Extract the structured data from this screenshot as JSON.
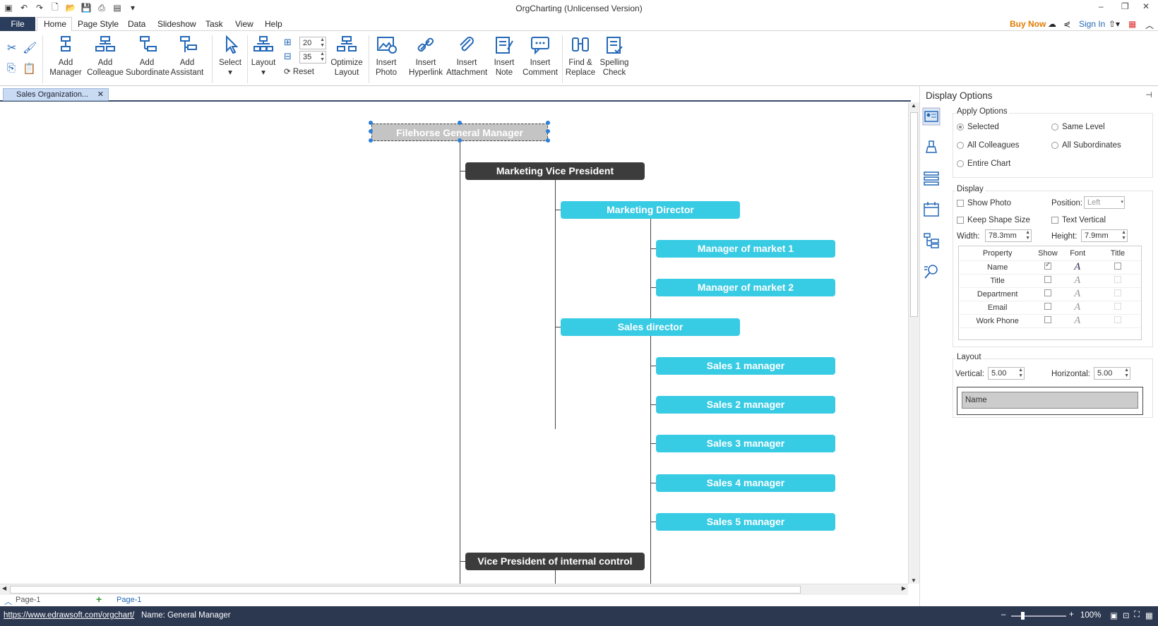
{
  "app_title": "OrgCharting (Unlicensed Version)",
  "menu": {
    "file": "File",
    "tabs": [
      "Home",
      "Page Style",
      "Data",
      "Slideshow",
      "Task",
      "View",
      "Help"
    ]
  },
  "topright": {
    "buy_now": "Buy Now",
    "sign_in": "Sign In"
  },
  "ribbon": {
    "add_manager": [
      "Add",
      "Manager"
    ],
    "add_colleague": [
      "Add",
      "Colleague"
    ],
    "add_subordinate": [
      "Add",
      "Subordinate"
    ],
    "add_assistant": [
      "Add",
      "Assistant"
    ],
    "select": "Select",
    "layout": "Layout",
    "spacing_h": "20",
    "spacing_v": "35",
    "reset": "Reset",
    "optimize_layout": [
      "Optimize",
      "Layout"
    ],
    "insert_photo": [
      "Insert",
      "Photo"
    ],
    "insert_hyperlink": [
      "Insert",
      "Hyperlink"
    ],
    "insert_attachment": [
      "Insert",
      "Attachment"
    ],
    "insert_note": [
      "Insert",
      "Note"
    ],
    "insert_comment": [
      "Insert",
      "Comment"
    ],
    "find_replace": [
      "Find &",
      "Replace"
    ],
    "spelling_check": [
      "Spelling",
      "Check"
    ]
  },
  "doc_tab": "Sales Organization...",
  "chart": {
    "root": "Filehorse General Manager",
    "vp_marketing": "Marketing Vice President",
    "marketing_director": "Marketing Director",
    "manager_market_1": "Manager of market 1",
    "manager_market_2": "Manager of market 2",
    "sales_director": "Sales director",
    "sales_managers": [
      "Sales 1 manager",
      "Sales 2 manager",
      "Sales 3 manager",
      "Sales 4 manager",
      "Sales 5 manager"
    ],
    "vp_internal_control": "Vice President of internal control"
  },
  "pages": {
    "page_tab_1": "Page-1",
    "page_tab_2": "Page-1"
  },
  "panel": {
    "title": "Display Options",
    "apply_options": {
      "title": "Apply Options",
      "selected": "Selected",
      "same_level": "Same Level",
      "all_colleagues": "All Colleagues",
      "all_subordinates": "All Subordinates",
      "entire_chart": "Entire Chart"
    },
    "display": {
      "title": "Display",
      "show_photo": "Show Photo",
      "position_label": "Position:",
      "position_value": "Left",
      "keep_shape_size": "Keep Shape Size",
      "text_vertical": "Text Vertical",
      "width_label": "Width:",
      "width_value": "78.3mm",
      "height_label": "Height:",
      "height_value": "7.9mm",
      "table_headers": [
        "Property",
        "Show",
        "Font",
        "Title"
      ],
      "properties": [
        "Name",
        "Title",
        "Department",
        "Email",
        "Work Phone"
      ]
    },
    "layout": {
      "title": "Layout",
      "vertical_label": "Vertical:",
      "vertical_value": "5.00",
      "horizontal_label": "Horizontal:",
      "horizontal_value": "5.00",
      "preview_label": "Name"
    }
  },
  "status": {
    "link": "https://www.edrawsoft.com/orgchart/",
    "name": "Name: General Manager",
    "zoom": "100%"
  },
  "colors": {
    "accent_dark": "#3c3c3c",
    "accent_cyan": "#38cbe4",
    "statusbar": "#2c3850",
    "buy_now": "#e07b00"
  }
}
